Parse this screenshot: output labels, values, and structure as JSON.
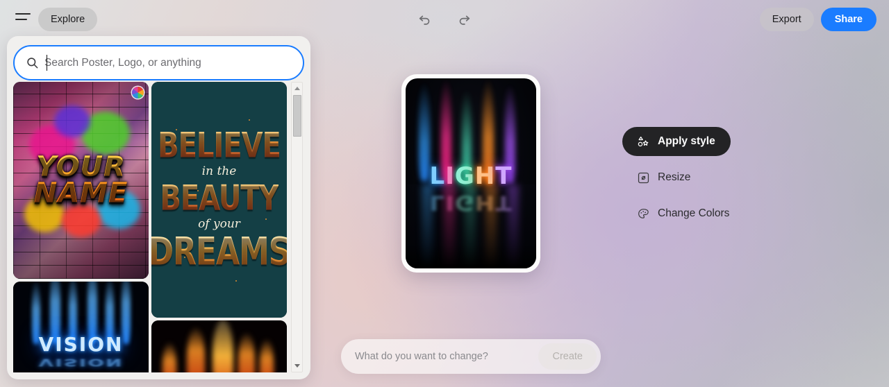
{
  "topbar": {
    "menu_icon": "hamburger-icon",
    "explore_label": "Explore",
    "undo_icon": "undo-arrow-icon",
    "redo_icon": "redo-arrow-icon",
    "export_label": "Export",
    "share_label": "Share",
    "share_color": "#1a7cff"
  },
  "search": {
    "icon": "search-icon",
    "placeholder": "Search Poster, Logo, or anything",
    "value": "",
    "focused": true,
    "focus_border_color": "#1a7cff"
  },
  "gallery": {
    "items": [
      {
        "title": "YOUR NAME",
        "line1": "YOUR",
        "line2": "NAME",
        "style": "graffiti-brick-wall",
        "badge_icon": "color-palette-badge-icon"
      },
      {
        "title": "BELIEVE in the BEAUTY of your DREAMS",
        "line1": "BELIEVE",
        "line2": "in the",
        "line3": "BEAUTY",
        "line4": "of your",
        "line5": "DREAMS",
        "style": "vintage-typography-teal"
      },
      {
        "title": "VISION",
        "line1": "VISION",
        "style": "blue-flame-reflection"
      },
      {
        "title": "Fire texture",
        "style": "orange-flames-black"
      }
    ],
    "scrollbar": {
      "up_arrow_icon": "scroll-up-arrow-icon",
      "down_arrow_icon": "scroll-down-arrow-icon"
    }
  },
  "canvas": {
    "artwork_title": "LIGHT",
    "letters": [
      {
        "char": "L",
        "color": "#2fa8ff"
      },
      {
        "char": "I",
        "color": "#ff2f95"
      },
      {
        "char": "G",
        "color": "#42e0b0"
      },
      {
        "char": "H",
        "color": "#ff8a2a"
      },
      {
        "char": "T",
        "color": "#a855f7"
      }
    ]
  },
  "actions": {
    "items": [
      {
        "label": "Apply style",
        "icon": "shapes-icon",
        "active": true
      },
      {
        "label": "Resize",
        "icon": "resize-icon",
        "active": false
      },
      {
        "label": "Change Colors",
        "icon": "palette-icon",
        "active": false
      }
    ]
  },
  "prompt": {
    "placeholder": "What do you want to change?",
    "value": "",
    "create_label": "Create",
    "create_disabled": true
  }
}
